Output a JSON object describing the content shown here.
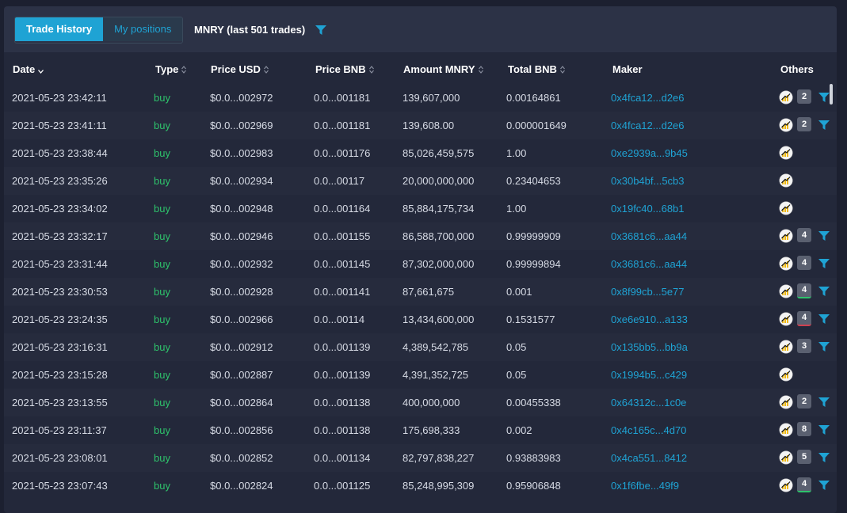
{
  "tabs": {
    "trade_history": "Trade History",
    "my_positions": "My positions"
  },
  "pair_title": "MNRY (last 501 trades)",
  "columns": {
    "date": "Date",
    "type": "Type",
    "price_usd": "Price USD",
    "price_bnb": "Price BNB",
    "amount": "Amount MNRY",
    "total": "Total BNB",
    "maker": "Maker",
    "others": "Others"
  },
  "colors": {
    "accent": "#1fa3d4",
    "buy": "#2ec26b",
    "coin": "#f0b90b"
  },
  "rows": [
    {
      "date": "2021-05-23 23:42:11",
      "type": "buy",
      "price_usd": "$0.0...002972",
      "price_bnb": "0.0...001181",
      "amount": "139,607,000",
      "total": "0.00164861",
      "maker": "0x4fca12...d2e6",
      "count": "2",
      "underline": "",
      "filter": true
    },
    {
      "date": "2021-05-23 23:41:11",
      "type": "buy",
      "price_usd": "$0.0...002969",
      "price_bnb": "0.0...001181",
      "amount": "139,608.00",
      "total": "0.000001649",
      "maker": "0x4fca12...d2e6",
      "count": "2",
      "underline": "",
      "filter": true
    },
    {
      "date": "2021-05-23 23:38:44",
      "type": "buy",
      "price_usd": "$0.0...002983",
      "price_bnb": "0.0...001176",
      "amount": "85,026,459,575",
      "total": "1.00",
      "maker": "0xe2939a...9b45",
      "count": "",
      "underline": "",
      "filter": false
    },
    {
      "date": "2021-05-23 23:35:26",
      "type": "buy",
      "price_usd": "$0.0...002934",
      "price_bnb": "0.0...00117",
      "amount": "20,000,000,000",
      "total": "0.23404653",
      "maker": "0x30b4bf...5cb3",
      "count": "",
      "underline": "",
      "filter": false
    },
    {
      "date": "2021-05-23 23:34:02",
      "type": "buy",
      "price_usd": "$0.0...002948",
      "price_bnb": "0.0...001164",
      "amount": "85,884,175,734",
      "total": "1.00",
      "maker": "0x19fc40...68b1",
      "count": "",
      "underline": "",
      "filter": false
    },
    {
      "date": "2021-05-23 23:32:17",
      "type": "buy",
      "price_usd": "$0.0...002946",
      "price_bnb": "0.0...001155",
      "amount": "86,588,700,000",
      "total": "0.99999909",
      "maker": "0x3681c6...aa44",
      "count": "4",
      "underline": "",
      "filter": true
    },
    {
      "date": "2021-05-23 23:31:44",
      "type": "buy",
      "price_usd": "$0.0...002932",
      "price_bnb": "0.0...001145",
      "amount": "87,302,000,000",
      "total": "0.99999894",
      "maker": "0x3681c6...aa44",
      "count": "4",
      "underline": "",
      "filter": true
    },
    {
      "date": "2021-05-23 23:30:53",
      "type": "buy",
      "price_usd": "$0.0...002928",
      "price_bnb": "0.0...001141",
      "amount": "87,661,675",
      "total": "0.001",
      "maker": "0x8f99cb...5e77",
      "count": "4",
      "underline": "green",
      "filter": true
    },
    {
      "date": "2021-05-23 23:24:35",
      "type": "buy",
      "price_usd": "$0.0...002966",
      "price_bnb": "0.0...00114",
      "amount": "13,434,600,000",
      "total": "0.1531577",
      "maker": "0xe6e910...a133",
      "count": "4",
      "underline": "red",
      "filter": true
    },
    {
      "date": "2021-05-23 23:16:31",
      "type": "buy",
      "price_usd": "$0.0...002912",
      "price_bnb": "0.0...001139",
      "amount": "4,389,542,785",
      "total": "0.05",
      "maker": "0x135bb5...bb9a",
      "count": "3",
      "underline": "",
      "filter": true
    },
    {
      "date": "2021-05-23 23:15:28",
      "type": "buy",
      "price_usd": "$0.0...002887",
      "price_bnb": "0.0...001139",
      "amount": "4,391,352,725",
      "total": "0.05",
      "maker": "0x1994b5...c429",
      "count": "",
      "underline": "",
      "filter": false
    },
    {
      "date": "2021-05-23 23:13:55",
      "type": "buy",
      "price_usd": "$0.0...002864",
      "price_bnb": "0.0...001138",
      "amount": "400,000,000",
      "total": "0.00455338",
      "maker": "0x64312c...1c0e",
      "count": "2",
      "underline": "",
      "filter": true
    },
    {
      "date": "2021-05-23 23:11:37",
      "type": "buy",
      "price_usd": "$0.0...002856",
      "price_bnb": "0.0...001138",
      "amount": "175,698,333",
      "total": "0.002",
      "maker": "0x4c165c...4d70",
      "count": "8",
      "underline": "",
      "filter": true
    },
    {
      "date": "2021-05-23 23:08:01",
      "type": "buy",
      "price_usd": "$0.0...002852",
      "price_bnb": "0.0...001134",
      "amount": "82,797,838,227",
      "total": "0.93883983",
      "maker": "0x4ca551...8412",
      "count": "5",
      "underline": "",
      "filter": true
    },
    {
      "date": "2021-05-23 23:07:43",
      "type": "buy",
      "price_usd": "$0.0...002824",
      "price_bnb": "0.0...001125",
      "amount": "85,248,995,309",
      "total": "0.95906848",
      "maker": "0x1f6fbe...49f9",
      "count": "4",
      "underline": "green",
      "filter": true
    }
  ]
}
